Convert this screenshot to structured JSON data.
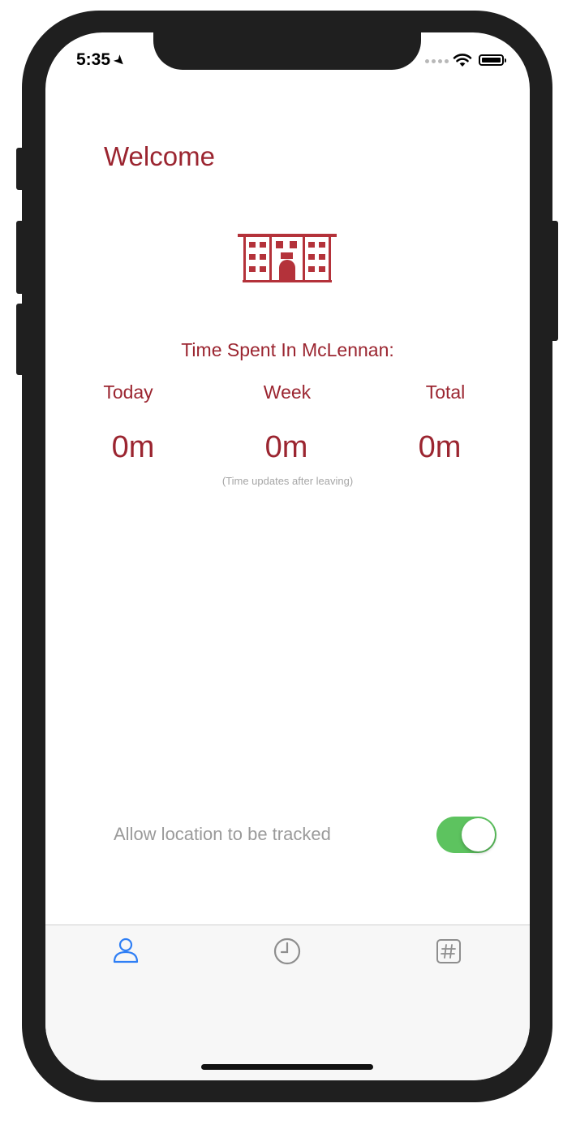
{
  "status_bar": {
    "time": "5:35",
    "location_icon": "location-arrow-icon"
  },
  "header": {
    "title": "Welcome"
  },
  "hero_icon": "building-icon",
  "stats": {
    "title": "Time Spent In McLennan:",
    "today_label": "Today",
    "week_label": "Week",
    "total_label": "Total",
    "today_value": "0m",
    "week_value": "0m",
    "total_value": "0m",
    "note": "(Time updates after leaving)"
  },
  "tracking": {
    "label": "Allow location to be tracked",
    "enabled": true
  },
  "tabs": [
    {
      "icon": "person-icon",
      "active": true
    },
    {
      "icon": "clock-icon",
      "active": false
    },
    {
      "icon": "hashtag-icon",
      "active": false
    }
  ],
  "colors": {
    "accent": "#9b2530",
    "toggle_on": "#5dc35f",
    "tab_active": "#2f7ff5",
    "tab_inactive": "#8e8e8e"
  }
}
